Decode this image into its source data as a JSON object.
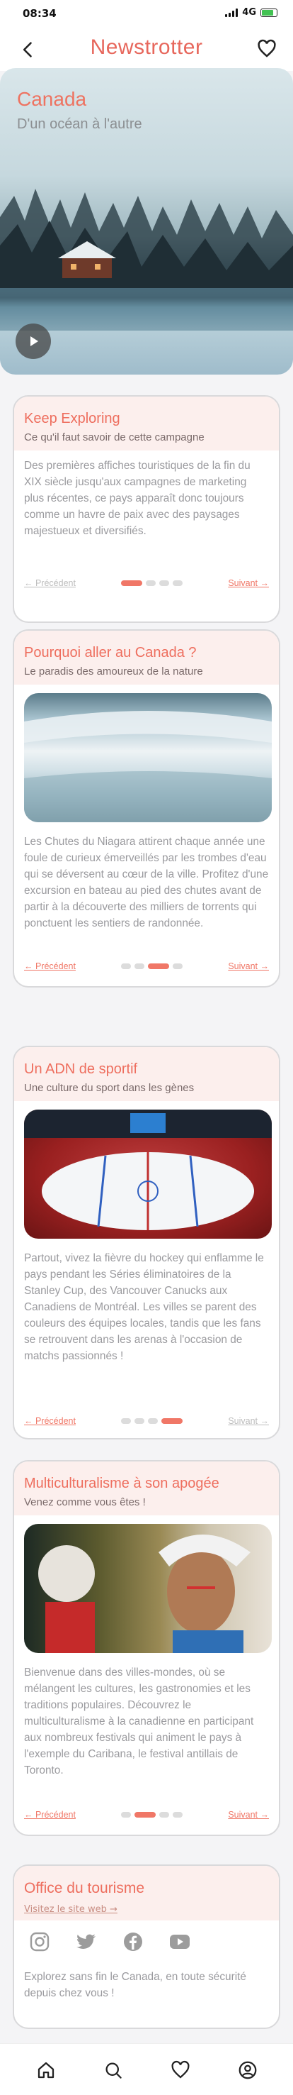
{
  "status": {
    "time": "08:34",
    "network": "4G"
  },
  "header": {
    "logo": "Newstrotter"
  },
  "hero": {
    "title": "Canada",
    "subtitle": "D'un océan à l'autre"
  },
  "cards": [
    {
      "title": "Keep Exploring",
      "subtitle": "Ce qu'il faut savoir de cette campagne",
      "text": "Des premières affiches touristiques de la fin du XIX siècle jusqu'aux campagnes de marketing plus récentes, ce pays apparaît donc toujours comme un havre de paix avec des paysages majestueux et diversifiés.",
      "prev": "Précédent",
      "next": "Suivant",
      "active_dot": 0
    },
    {
      "title": "Pourquoi aller au Canada ?",
      "subtitle": "Le paradis des amoureux de la nature",
      "text": "Les Chutes du Niagara attirent chaque année une foule de curieux émerveillés par les trombes d'eau qui se déversent au cœur de la ville. Profitez d'une excursion en bateau au pied des chutes avant de partir à la découverte des milliers de torrents qui ponctuent les sentiers de randonnée.",
      "prev": "Précédent",
      "next": "Suivant",
      "active_dot": 2
    },
    {
      "title": "Un ADN de sportif",
      "subtitle": "Une culture du sport dans les gènes",
      "text": "Partout, vivez la fièvre du hockey qui enflamme le pays pendant les Séries éliminatoires de la Stanley Cup, des Vancouver Canucks aux Canadiens de Montréal. Les villes se parent des couleurs des équipes locales, tandis que les fans se retrouvent dans les arenas à l'occasion de matchs passionnés !",
      "prev": "Précédent",
      "next": "Suivant",
      "active_dot": 3
    },
    {
      "title": "Multiculturalisme à son apogée",
      "subtitle": "Venez comme vous êtes !",
      "text": "Bienvenue dans des villes-mondes, où se mélangent les cultures, les gastronomies et les traditions populaires. Découvrez le multiculturalisme à la canadienne en participant aux nombreux festivals qui animent le pays à l'exemple du Caribana, le festival antillais de Toronto.",
      "prev": "Précédent",
      "next": "Suivant",
      "active_dot": 1
    }
  ],
  "office": {
    "title": "Office du tourisme",
    "link": "Visitez le site web →",
    "socials": [
      "instagram-icon",
      "twitter-icon",
      "facebook-icon",
      "youtube-icon"
    ],
    "text": "Explorez sans fin le Canada, en toute sécurité depuis chez vous !"
  },
  "bottom_nav": [
    "home-icon",
    "search-icon",
    "heart-icon",
    "profile-icon"
  ],
  "colors": {
    "accent": "#f07767",
    "card_head": "#fcefed"
  }
}
